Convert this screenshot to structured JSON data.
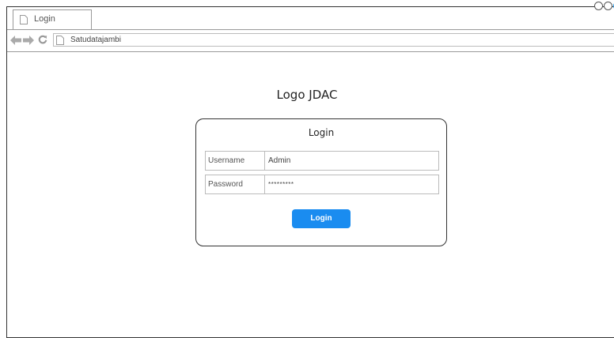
{
  "tab": {
    "title": "Login",
    "icon": "page-icon"
  },
  "window_controls": [
    "circle-icon",
    "circle-icon",
    "circle-icon"
  ],
  "address_bar": {
    "url": "Satudatajambi",
    "icons": [
      "back-arrow-icon",
      "forward-arrow-icon",
      "refresh-icon",
      "page-icon"
    ]
  },
  "main": {
    "logo_text": "Logo JDAC",
    "login_card": {
      "title": "Login",
      "username": {
        "label": "Username",
        "value": "Admin"
      },
      "password": {
        "label": "Password",
        "value": "*********"
      },
      "button_label": "Login"
    }
  },
  "colors": {
    "accent": "#1a8cf0",
    "border": "#333333"
  }
}
